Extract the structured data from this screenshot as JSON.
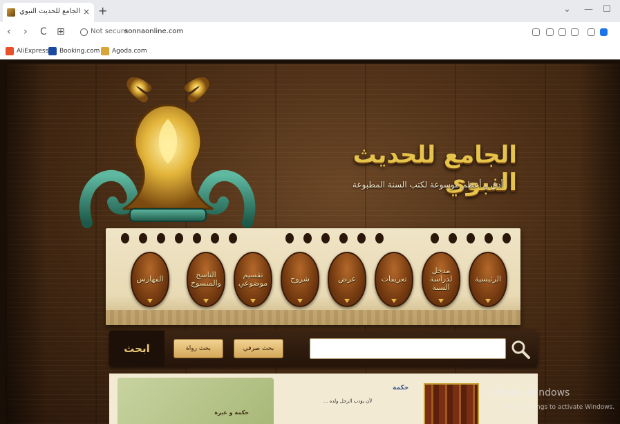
{
  "browser": {
    "tab_title": "الجامع للحديث النبوي",
    "tab_close": "×",
    "new_tab": "+",
    "window_controls": [
      "⌄",
      "—",
      "☐"
    ],
    "nav": {
      "back": "‹",
      "forward": "›",
      "reload": "C",
      "apps": "⊞"
    },
    "security_label": "Not secure",
    "url": "sonnaonline.com",
    "bookmarks": [
      "AliExpress",
      "Booking.com",
      "Agoda.com"
    ],
    "bookmark_colors": [
      "#e8502a",
      "#1a4aa0",
      "#d9a53a"
    ]
  },
  "site": {
    "title": "الجامع للحديث النبوي",
    "subtitle": "أدق و أعظم موسوعة لكتب السنة المطبوعة",
    "menu": [
      "الرئيسية",
      "مدخل لدراسة السنة",
      "تعريفات",
      "عرض",
      "شروح",
      "تقسيم موضوعي",
      "الناسخ والمنسوخ",
      "الفهارس"
    ],
    "search": {
      "head_label": "ابحث",
      "rawi_button": "بحث رواة",
      "sarfi_button": "بحث صرفي",
      "input_value": "",
      "icon": "search-icon"
    },
    "lower": {
      "wisdom_title": "حكمة",
      "wisdom_text": "لأن يؤدب الرجل ولده ...",
      "green_caption": "حكمة و عبرة"
    }
  },
  "overlay": {
    "activate_title": "Activate Windows",
    "activate_sub": "Go to Settings to activate Windows."
  },
  "colors": {
    "accent_gold": "#e6c34a",
    "parchment": "#efe4c6",
    "menu_brown": "#7a3e12"
  }
}
